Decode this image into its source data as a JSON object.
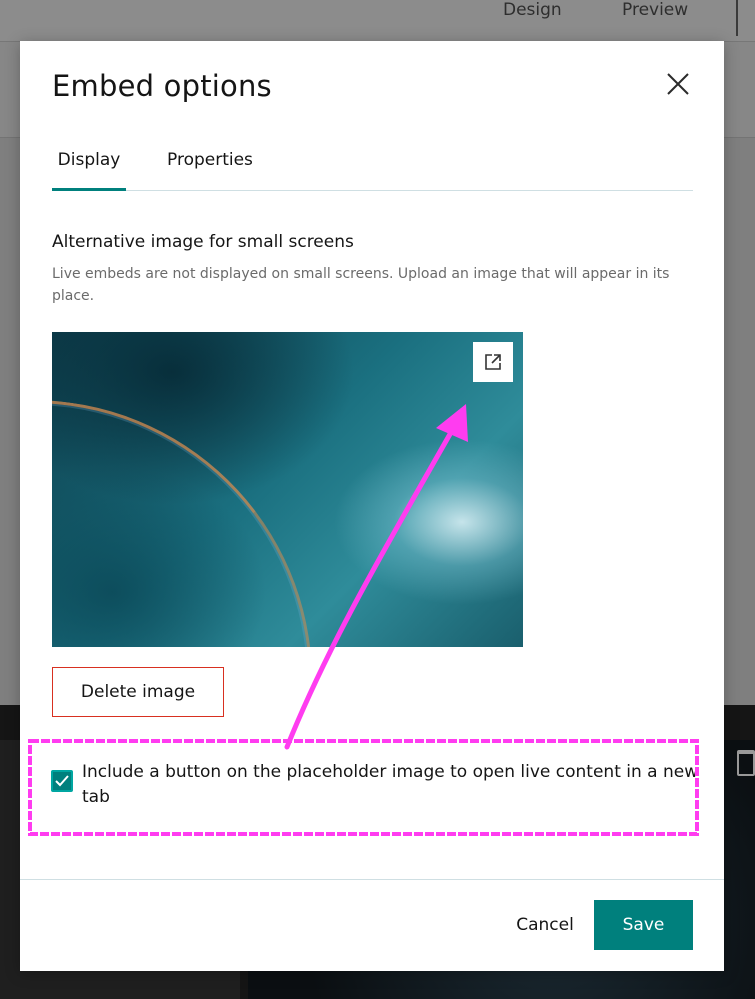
{
  "background_app": {
    "tabs": [
      "Design",
      "Preview"
    ]
  },
  "dialog": {
    "title": "Embed options",
    "tabs": [
      {
        "label": "Display",
        "active": true
      },
      {
        "label": "Properties",
        "active": false
      }
    ],
    "section": {
      "heading": "Alternative image for small screens",
      "description": "Live embeds are not displayed on small screens. Upload an image that will appear in its place."
    },
    "image": {
      "open_button_icon": "open-in-new-tab-icon"
    },
    "delete_button_label": "Delete image",
    "checkbox": {
      "checked": true,
      "label": "Include a button on the placeholder image to open live content in a new tab"
    },
    "footer": {
      "cancel_label": "Cancel",
      "save_label": "Save"
    },
    "close_icon": "close-icon"
  },
  "colors": {
    "accent": "#00807d",
    "danger_border": "#d83020",
    "annotation": "#ff3cf0"
  }
}
